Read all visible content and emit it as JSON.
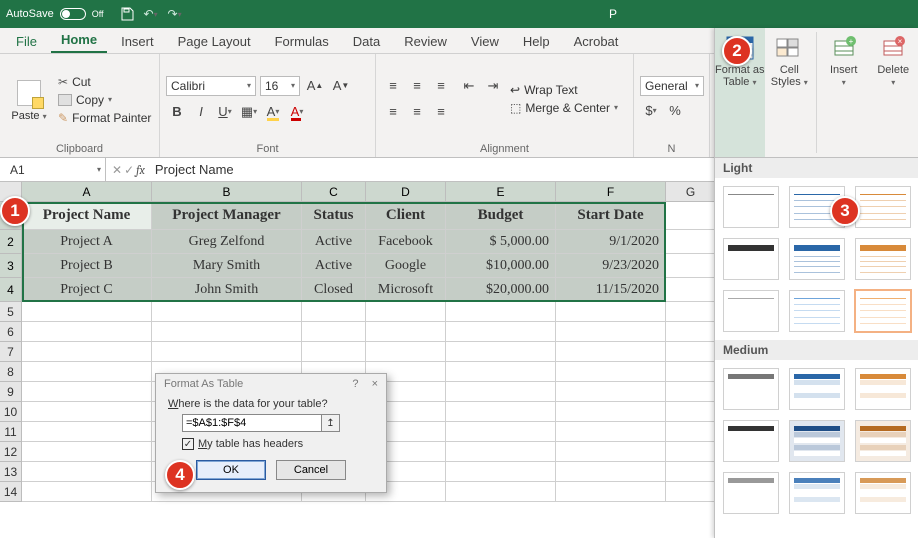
{
  "titlebar": {
    "autosave_label": "AutoSave",
    "autosave_state": "Off",
    "doc_title": "P"
  },
  "tabs": {
    "file": "File",
    "home": "Home",
    "insert": "Insert",
    "page_layout": "Page Layout",
    "formulas": "Formulas",
    "data": "Data",
    "review": "Review",
    "view": "View",
    "help": "Help",
    "acrobat": "Acrobat"
  },
  "clipboard": {
    "paste": "Paste",
    "cut": "Cut",
    "copy": "Copy",
    "fmt_painter": "Format Painter",
    "group": "Clipboard"
  },
  "font": {
    "name": "Calibri",
    "size": "16",
    "group": "Font"
  },
  "align": {
    "wrap": "Wrap Text",
    "merge": "Merge & Center",
    "group": "Alignment"
  },
  "number": {
    "general": "General",
    "group": "N"
  },
  "styles": {
    "fmt_table": "Format as Table",
    "cell_styles": "Cell Styles"
  },
  "cells": {
    "insert": "Insert",
    "delete": "Delete"
  },
  "fbar": {
    "namebox": "A1",
    "formula": "Project Name"
  },
  "columns": [
    "A",
    "B",
    "C",
    "D",
    "E",
    "F",
    "G"
  ],
  "headers": [
    "Project Name",
    "Project Manager",
    "Status",
    "Client",
    "Budget",
    "Start Date"
  ],
  "rows": [
    {
      "name": "Project A",
      "mgr": "Greg Zelfond",
      "status": "Active",
      "client": "Facebook",
      "budget": "$  5,000.00",
      "date": "9/1/2020"
    },
    {
      "name": "Project B",
      "mgr": "Mary Smith",
      "status": "Active",
      "client": "Google",
      "budget": "$10,000.00",
      "date": "9/23/2020"
    },
    {
      "name": "Project C",
      "mgr": "John Smith",
      "status": "Closed",
      "client": "Microsoft",
      "budget": "$20,000.00",
      "date": "11/15/2020"
    }
  ],
  "dialog": {
    "title": "Format As Table",
    "prompt": "Where is the data for your table?",
    "range": "=$A$1:$F$4",
    "headers_chk": "My table has headers",
    "ok": "OK",
    "cancel": "Cancel",
    "help": "?",
    "close": "×",
    "prompt_u": "W",
    "chk_u": "M"
  },
  "gallery": {
    "light": "Light",
    "medium": "Medium"
  },
  "callouts": {
    "c1": "1",
    "c2": "2",
    "c3": "3",
    "c4": "4"
  }
}
